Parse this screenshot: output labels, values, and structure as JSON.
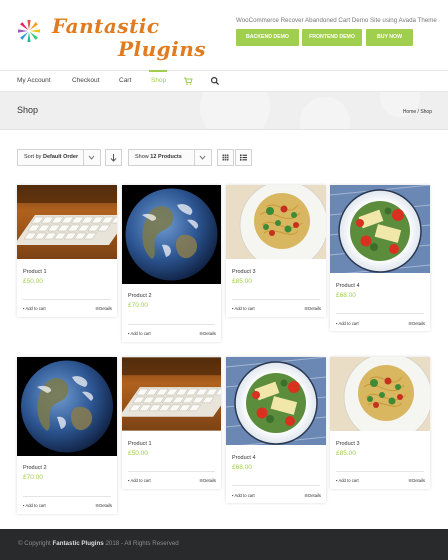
{
  "header": {
    "logo_line1": "Fantastic",
    "logo_line2": "Plugins",
    "tagline": "WooCommerce Recover Abandoned Cart Demo Site using Avada Theme",
    "buttons": [
      "BACKEND DEMO",
      "FRONTEND DEMO",
      "BUY NOW"
    ]
  },
  "nav": {
    "items": [
      "My Account",
      "Checkout",
      "Cart",
      "Shop"
    ],
    "active": "Shop",
    "icons": [
      "cart-icon",
      "search-icon"
    ]
  },
  "titlebar": {
    "title": "Shop",
    "breadcrumb": "Home / Shop"
  },
  "toolbar": {
    "sort_prefix": "Sort by",
    "sort_value": "Default Order",
    "show_prefix": "Show",
    "show_value": "12 Products",
    "icons": [
      "sort-direction-icon",
      "grid-view-icon",
      "list-view-icon"
    ]
  },
  "products": [
    {
      "name": "Product 1",
      "price": "£50.00",
      "image": "keyboard",
      "cart": "Add to cart",
      "details": "Details"
    },
    {
      "name": "Product 2",
      "price": "£70.00",
      "image": "earth",
      "cart": "Add to cart",
      "details": "Details"
    },
    {
      "name": "Product 3",
      "price": "£85.00",
      "image": "pasta",
      "cart": "Add to cart",
      "details": "Details"
    },
    {
      "name": "Product 4",
      "price": "£68.00",
      "image": "salad-bowl",
      "cart": "Add to cart",
      "details": "Details"
    },
    {
      "name": "Product 2",
      "price": "£70.00",
      "image": "earth",
      "cart": "Add to cart",
      "details": "Details"
    },
    {
      "name": "Product 1",
      "price": "£50.00",
      "image": "keyboard",
      "cart": "Add to cart",
      "details": "Details"
    },
    {
      "name": "Product 4",
      "price": "£68.00",
      "image": "salad-bowl",
      "cart": "Add to cart",
      "details": "Details"
    },
    {
      "name": "Product 3",
      "price": "£85.00",
      "image": "pasta",
      "cart": "Add to cart",
      "details": "Details"
    }
  ],
  "footer": {
    "prefix": "© Copyright",
    "brand": "Fantastic Plugins",
    "suffix": "2018 - All Rights Reserved"
  },
  "colors": {
    "accent": "#a0ce4e",
    "logo": "#e07b1f",
    "footer_bg": "#282a2b"
  }
}
